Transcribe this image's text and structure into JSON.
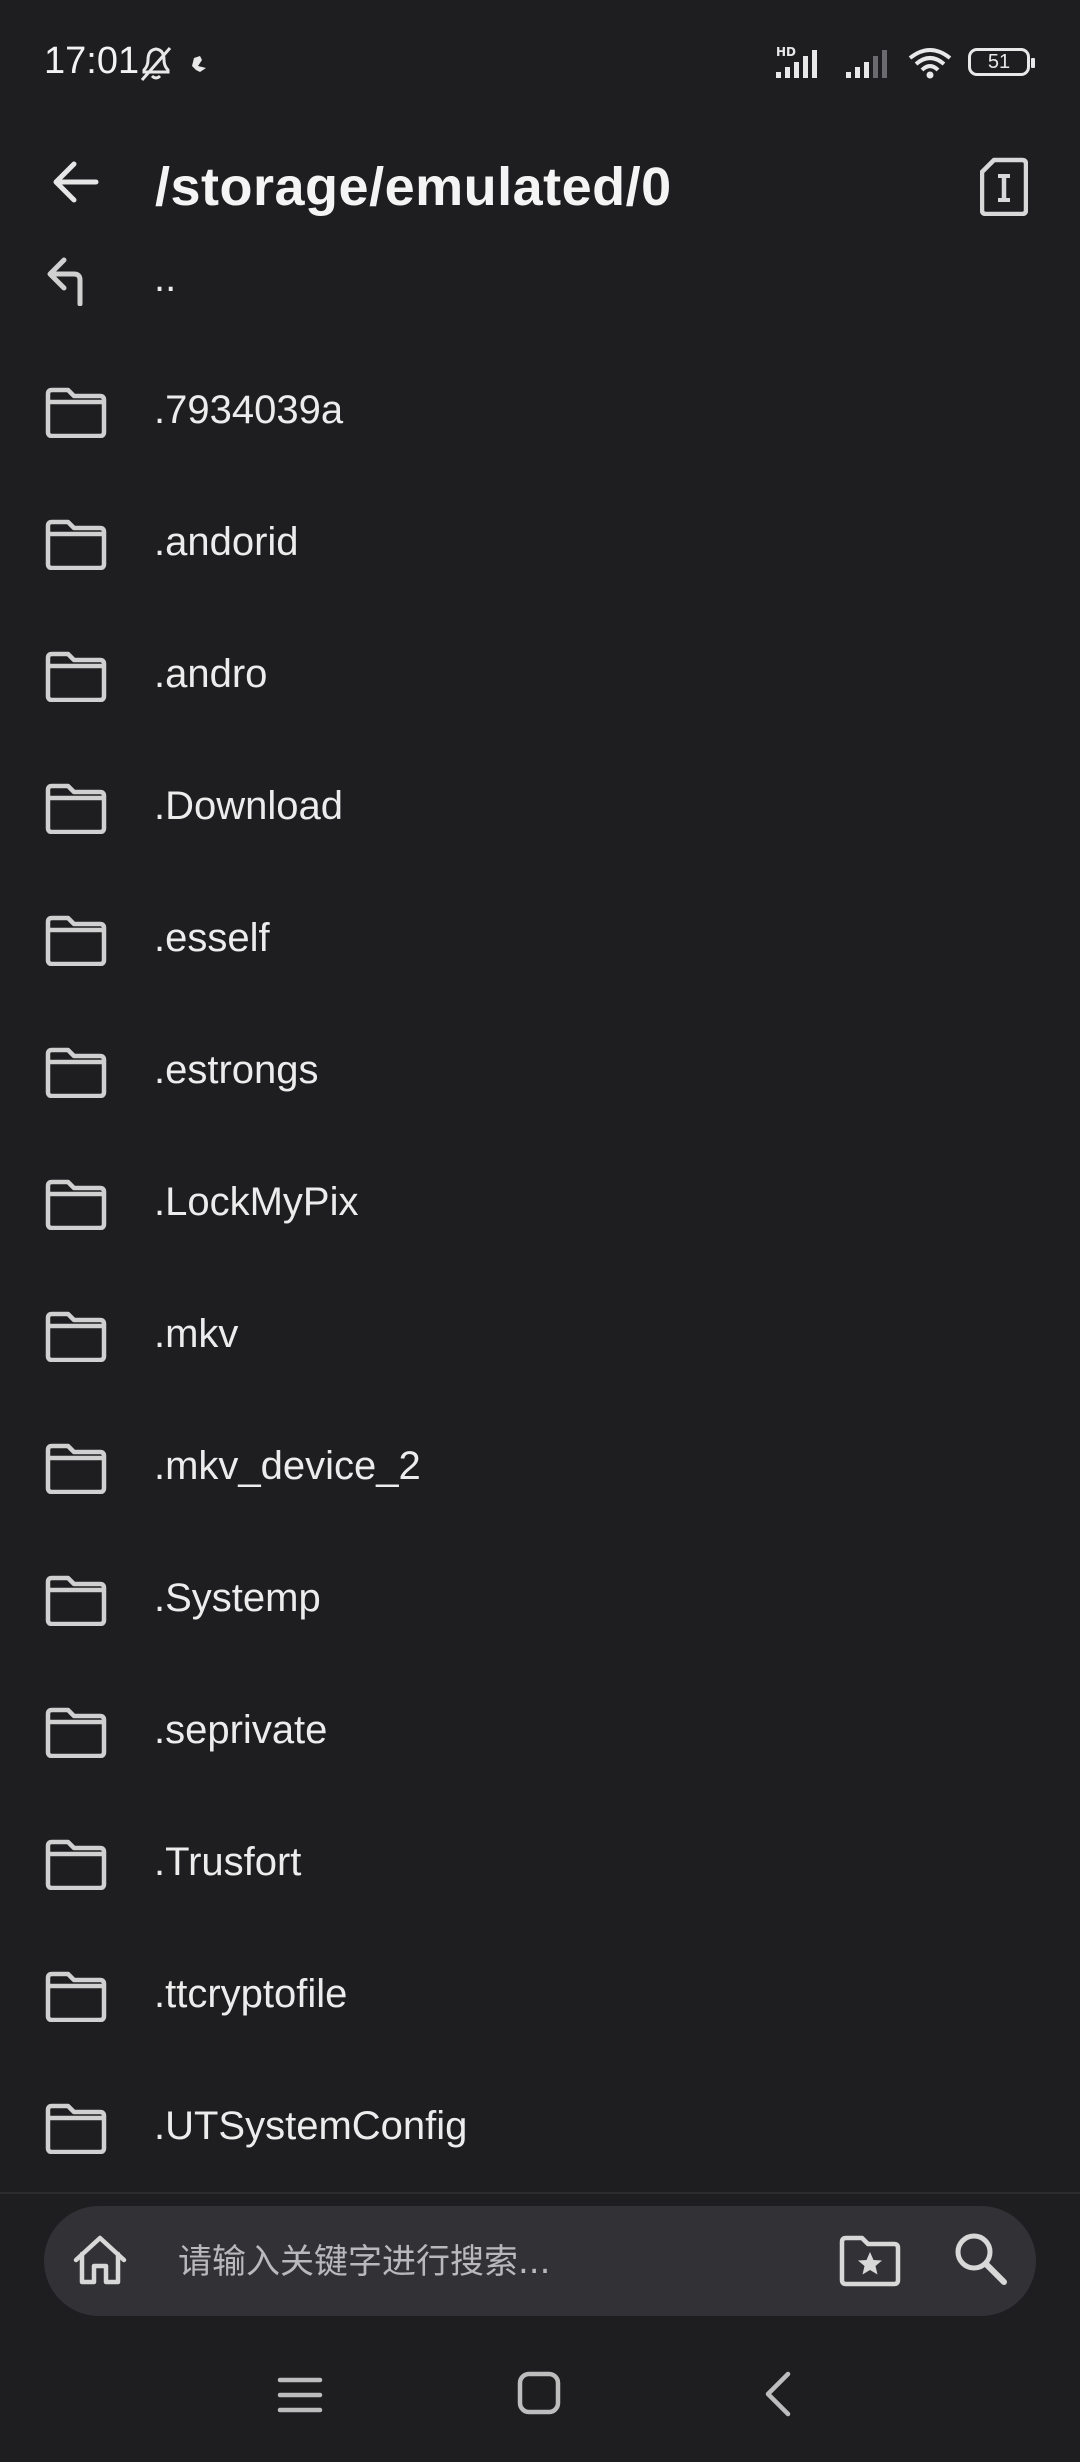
{
  "status_bar": {
    "time": "17:01",
    "battery": "51",
    "hd_label": "HD",
    "icons": [
      "bell-off-icon",
      "app-notification-icon",
      "signal-hd-icon",
      "signal-icon",
      "wifi-icon",
      "battery-icon"
    ]
  },
  "header": {
    "title": "/storage/emulated/0",
    "back_icon": "arrow-left-icon",
    "action_icon": "sd-card-icon"
  },
  "list": {
    "items": [
      {
        "label": "..",
        "icon": "parent-directory-icon"
      },
      {
        "label": ".7934039a",
        "icon": "folder-icon"
      },
      {
        "label": ".andorid",
        "icon": "folder-icon"
      },
      {
        "label": ".andro",
        "icon": "folder-icon"
      },
      {
        "label": ".Download",
        "icon": "folder-icon"
      },
      {
        "label": ".esself",
        "icon": "folder-icon"
      },
      {
        "label": ".estrongs",
        "icon": "folder-icon"
      },
      {
        "label": ".LockMyPix",
        "icon": "folder-icon"
      },
      {
        "label": ".mkv",
        "icon": "folder-icon"
      },
      {
        "label": ".mkv_device_2",
        "icon": "folder-icon"
      },
      {
        "label": ".Systemp",
        "icon": "folder-icon"
      },
      {
        "label": ".seprivate",
        "icon": "folder-icon"
      },
      {
        "label": ".Trusfort",
        "icon": "folder-icon"
      },
      {
        "label": ".ttcryptofile",
        "icon": "folder-icon"
      },
      {
        "label": ".UTSystemConfig",
        "icon": "folder-icon"
      }
    ]
  },
  "bottom_bar": {
    "search_placeholder": "请输入关键字进行搜索...",
    "home_icon": "home-icon",
    "bookmark_icon": "folder-star-icon",
    "search_icon": "search-icon"
  },
  "nav_bar": {
    "icons": [
      "menu-icon",
      "home-square-icon",
      "back-chevron-icon"
    ]
  },
  "colors": {
    "background": "#1e1e20",
    "pill": "#323236",
    "text": "#ececec",
    "icon": "#d8d8d8"
  }
}
